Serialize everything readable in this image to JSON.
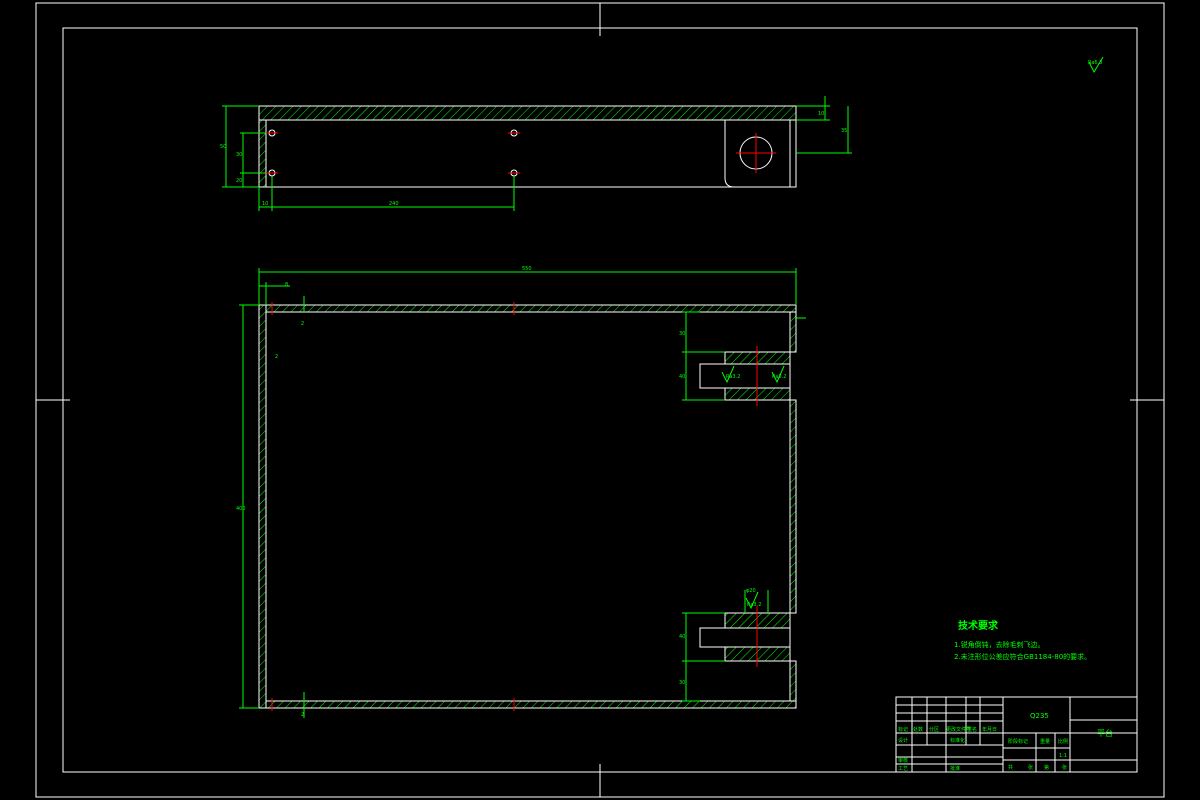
{
  "colors": {
    "background": "#000000",
    "frame": "#ffffff",
    "part_outline": "#ffffff",
    "hatch": "#00ff00",
    "dimension": "#00ff00",
    "center_mark": "#ff0000",
    "text": "#00ff00"
  },
  "drawing": {
    "roughness_top_right": "Ra6.3",
    "top_view": {
      "dim_height_total": "50",
      "dim_height_upper": "30",
      "dim_height_lower": "20",
      "dim_left_offset": "10",
      "dim_hole_spacing": "240",
      "dim_boss_small": "10",
      "dim_boss_large": "35"
    },
    "front_view": {
      "dim_width_total": "550",
      "dim_wall": "8",
      "dim_height_total": "400",
      "dim_top_gap": "2",
      "dim_side_mark": "2",
      "dim_top_slot_gap": "30",
      "dim_top_slot_height": "40",
      "dim_bottom_slot_height": "40",
      "dim_bottom_slot_gap": "30",
      "roughness_top_slot": "Ra3.2",
      "roughness_top_slot_end": "Ra3.2",
      "roughness_bottom_slot": "Ra3.2",
      "dim_bottom_slot_width": "φ20",
      "dim_corner_mark": "2"
    },
    "tech_requirements": {
      "title": "技术要求",
      "line1": "1.锐角倒钝，去除毛刺飞边。",
      "line2": "2.未注形位公差应符合GB1184-80的要求。"
    },
    "title_block": {
      "material": "Q235",
      "part_name": "平台",
      "scale": "1:1",
      "labels": [
        "标记",
        "处数",
        "分区",
        "更改文件号",
        "签名",
        "年月日"
      ],
      "design": "设计",
      "standardization": "标准化",
      "review": "审核",
      "process": "工艺",
      "approve": "批准",
      "stage_mark": "阶段标记",
      "weight": "重量",
      "ratio": "比例",
      "sheet_total": "共",
      "sheet_label": "张",
      "sheet_no": "第",
      "sheet_no_label": "张"
    }
  }
}
